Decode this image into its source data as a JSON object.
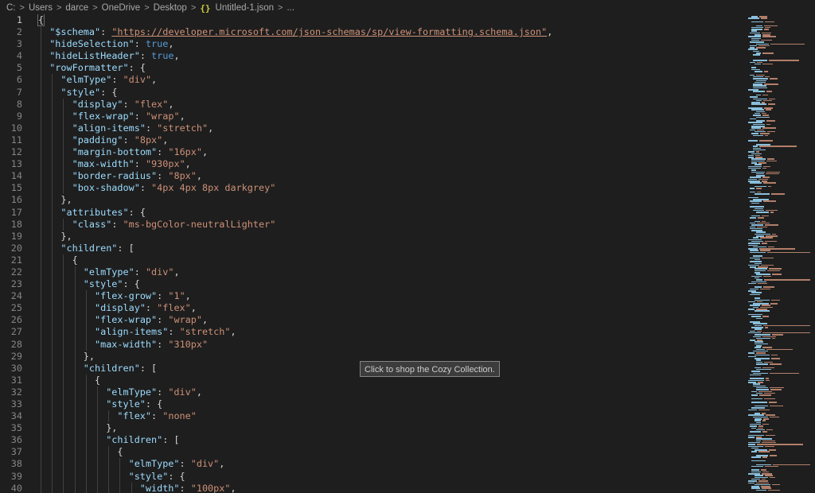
{
  "breadcrumb": {
    "items": [
      "C:",
      "Users",
      "darce",
      "OneDrive",
      "Desktop",
      "Untitled-1.json",
      "..."
    ],
    "file_icon": "json-icon",
    "file_icon_glyph": "{}",
    "separator_glyph": ">"
  },
  "tooltip": {
    "text": "Click to shop the Cozy Collection."
  },
  "colors": {
    "background": "#1e1e1e",
    "key": "#9cdcfe",
    "string": "#ce9178",
    "boolean": "#569cd6",
    "punctuation": "#d4d4d4",
    "line_number": "#858585"
  },
  "editor": {
    "active_line": 1,
    "lines": [
      {
        "n": "1",
        "indent": 0,
        "t": [
          [
            "p",
            "{"
          ]
        ]
      },
      {
        "n": "2",
        "indent": 1,
        "t": [
          [
            "k",
            "\"$schema\""
          ],
          [
            "p",
            ": "
          ],
          [
            "su",
            "\"https://developer.microsoft.com/json-schemas/sp/view-formatting.schema.json\""
          ],
          [
            "p",
            ","
          ]
        ]
      },
      {
        "n": "3",
        "indent": 1,
        "t": [
          [
            "k",
            "\"hideSelection\""
          ],
          [
            "p",
            ": "
          ],
          [
            "b",
            "true"
          ],
          [
            "p",
            ","
          ]
        ]
      },
      {
        "n": "4",
        "indent": 1,
        "t": [
          [
            "k",
            "\"hideListHeader\""
          ],
          [
            "p",
            ": "
          ],
          [
            "b",
            "true"
          ],
          [
            "p",
            ","
          ]
        ]
      },
      {
        "n": "5",
        "indent": 1,
        "t": [
          [
            "k",
            "\"rowFormatter\""
          ],
          [
            "p",
            ": {"
          ]
        ]
      },
      {
        "n": "6",
        "indent": 2,
        "t": [
          [
            "k",
            "\"elmType\""
          ],
          [
            "p",
            ": "
          ],
          [
            "s",
            "\"div\""
          ],
          [
            "p",
            ","
          ]
        ]
      },
      {
        "n": "7",
        "indent": 2,
        "t": [
          [
            "k",
            "\"style\""
          ],
          [
            "p",
            ": {"
          ]
        ]
      },
      {
        "n": "8",
        "indent": 3,
        "t": [
          [
            "k",
            "\"display\""
          ],
          [
            "p",
            ": "
          ],
          [
            "s",
            "\"flex\""
          ],
          [
            "p",
            ","
          ]
        ]
      },
      {
        "n": "9",
        "indent": 3,
        "t": [
          [
            "k",
            "\"flex-wrap\""
          ],
          [
            "p",
            ": "
          ],
          [
            "s",
            "\"wrap\""
          ],
          [
            "p",
            ","
          ]
        ]
      },
      {
        "n": "10",
        "indent": 3,
        "t": [
          [
            "k",
            "\"align-items\""
          ],
          [
            "p",
            ": "
          ],
          [
            "s",
            "\"stretch\""
          ],
          [
            "p",
            ","
          ]
        ]
      },
      {
        "n": "11",
        "indent": 3,
        "t": [
          [
            "k",
            "\"padding\""
          ],
          [
            "p",
            ": "
          ],
          [
            "s",
            "\"8px\""
          ],
          [
            "p",
            ","
          ]
        ]
      },
      {
        "n": "12",
        "indent": 3,
        "t": [
          [
            "k",
            "\"margin-bottom\""
          ],
          [
            "p",
            ": "
          ],
          [
            "s",
            "\"16px\""
          ],
          [
            "p",
            ","
          ]
        ]
      },
      {
        "n": "13",
        "indent": 3,
        "t": [
          [
            "k",
            "\"max-width\""
          ],
          [
            "p",
            ": "
          ],
          [
            "s",
            "\"930px\""
          ],
          [
            "p",
            ","
          ]
        ]
      },
      {
        "n": "14",
        "indent": 3,
        "t": [
          [
            "k",
            "\"border-radius\""
          ],
          [
            "p",
            ": "
          ],
          [
            "s",
            "\"8px\""
          ],
          [
            "p",
            ","
          ]
        ]
      },
      {
        "n": "15",
        "indent": 3,
        "t": [
          [
            "k",
            "\"box-shadow\""
          ],
          [
            "p",
            ": "
          ],
          [
            "s",
            "\"4px 4px 8px darkgrey\""
          ]
        ]
      },
      {
        "n": "16",
        "indent": 2,
        "t": [
          [
            "p",
            "},"
          ]
        ]
      },
      {
        "n": "17",
        "indent": 2,
        "t": [
          [
            "k",
            "\"attributes\""
          ],
          [
            "p",
            ": {"
          ]
        ]
      },
      {
        "n": "18",
        "indent": 3,
        "t": [
          [
            "k",
            "\"class\""
          ],
          [
            "p",
            ": "
          ],
          [
            "s",
            "\"ms-bgColor-neutralLighter\""
          ]
        ]
      },
      {
        "n": "19",
        "indent": 2,
        "t": [
          [
            "p",
            "},"
          ]
        ]
      },
      {
        "n": "20",
        "indent": 2,
        "t": [
          [
            "k",
            "\"children\""
          ],
          [
            "p",
            ": ["
          ]
        ]
      },
      {
        "n": "21",
        "indent": 3,
        "t": [
          [
            "p",
            "{"
          ]
        ]
      },
      {
        "n": "22",
        "indent": 4,
        "t": [
          [
            "k",
            "\"elmType\""
          ],
          [
            "p",
            ": "
          ],
          [
            "s",
            "\"div\""
          ],
          [
            "p",
            ","
          ]
        ]
      },
      {
        "n": "23",
        "indent": 4,
        "t": [
          [
            "k",
            "\"style\""
          ],
          [
            "p",
            ": {"
          ]
        ]
      },
      {
        "n": "24",
        "indent": 5,
        "t": [
          [
            "k",
            "\"flex-grow\""
          ],
          [
            "p",
            ": "
          ],
          [
            "s",
            "\"1\""
          ],
          [
            "p",
            ","
          ]
        ]
      },
      {
        "n": "25",
        "indent": 5,
        "t": [
          [
            "k",
            "\"display\""
          ],
          [
            "p",
            ": "
          ],
          [
            "s",
            "\"flex\""
          ],
          [
            "p",
            ","
          ]
        ]
      },
      {
        "n": "26",
        "indent": 5,
        "t": [
          [
            "k",
            "\"flex-wrap\""
          ],
          [
            "p",
            ": "
          ],
          [
            "s",
            "\"wrap\""
          ],
          [
            "p",
            ","
          ]
        ]
      },
      {
        "n": "27",
        "indent": 5,
        "t": [
          [
            "k",
            "\"align-items\""
          ],
          [
            "p",
            ": "
          ],
          [
            "s",
            "\"stretch\""
          ],
          [
            "p",
            ","
          ]
        ]
      },
      {
        "n": "28",
        "indent": 5,
        "t": [
          [
            "k",
            "\"max-width\""
          ],
          [
            "p",
            ": "
          ],
          [
            "s",
            "\"310px\""
          ]
        ]
      },
      {
        "n": "29",
        "indent": 4,
        "t": [
          [
            "p",
            "},"
          ]
        ]
      },
      {
        "n": "30",
        "indent": 4,
        "t": [
          [
            "k",
            "\"children\""
          ],
          [
            "p",
            ": ["
          ]
        ]
      },
      {
        "n": "31",
        "indent": 5,
        "t": [
          [
            "p",
            "{"
          ]
        ]
      },
      {
        "n": "32",
        "indent": 6,
        "t": [
          [
            "k",
            "\"elmType\""
          ],
          [
            "p",
            ": "
          ],
          [
            "s",
            "\"div\""
          ],
          [
            "p",
            ","
          ]
        ]
      },
      {
        "n": "33",
        "indent": 6,
        "t": [
          [
            "k",
            "\"style\""
          ],
          [
            "p",
            ": {"
          ]
        ]
      },
      {
        "n": "34",
        "indent": 7,
        "t": [
          [
            "k",
            "\"flex\""
          ],
          [
            "p",
            ": "
          ],
          [
            "s",
            "\"none\""
          ]
        ]
      },
      {
        "n": "35",
        "indent": 6,
        "t": [
          [
            "p",
            "},"
          ]
        ]
      },
      {
        "n": "36",
        "indent": 6,
        "t": [
          [
            "k",
            "\"children\""
          ],
          [
            "p",
            ": ["
          ]
        ]
      },
      {
        "n": "37",
        "indent": 7,
        "t": [
          [
            "p",
            "{"
          ]
        ]
      },
      {
        "n": "38",
        "indent": 8,
        "t": [
          [
            "k",
            "\"elmType\""
          ],
          [
            "p",
            ": "
          ],
          [
            "s",
            "\"div\""
          ],
          [
            "p",
            ","
          ]
        ]
      },
      {
        "n": "39",
        "indent": 8,
        "t": [
          [
            "k",
            "\"style\""
          ],
          [
            "p",
            ": {"
          ]
        ]
      },
      {
        "n": "40",
        "indent": 9,
        "t": [
          [
            "k",
            "\"width\""
          ],
          [
            "p",
            ": "
          ],
          [
            "s",
            "\"100px\""
          ],
          [
            "p",
            ","
          ]
        ]
      }
    ]
  }
}
